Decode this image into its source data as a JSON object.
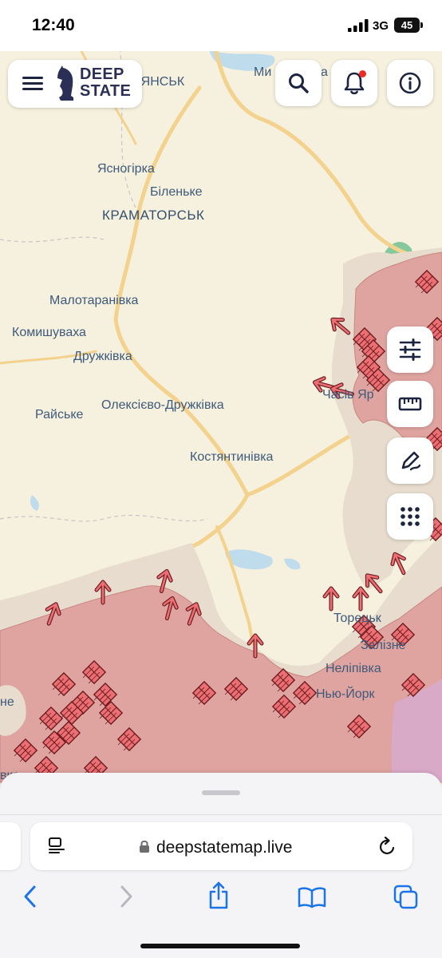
{
  "status_bar": {
    "time": "12:40",
    "network": "3G",
    "battery": "45"
  },
  "header": {
    "brand_line1": "DEEP",
    "brand_line2": "STATE",
    "menu_icon": "hamburger-menu-icon",
    "search_icon": "search-icon",
    "notifications_icon": "bell-icon",
    "info_icon": "info-icon",
    "notification_dot_color": "#ee2a24"
  },
  "map": {
    "colors": {
      "land": "#f6f0de",
      "occupied": "#dfa4a0",
      "contested": "#e7dccd",
      "roads": "#f3d28d",
      "forest": "#84c89c",
      "water": "#bedcec",
      "marker": "#e96b70",
      "other_zone": "#d9aac8"
    },
    "labels": [
      "ЛОВ'ЯНСЬК",
      "Ми",
      "а",
      "Ясногірка",
      "Біленьке",
      "КРАМАТОРСЬК",
      "Малотаранівка",
      "Комишуваха",
      "Дружківка",
      "Часів Яр",
      "Олексієво-Дружківка",
      "Райське",
      "Костянтинівка",
      "Торецьк",
      "Залізне",
      "Неліпівка",
      "Нью-Йорк",
      "не",
      "вка"
    ],
    "tools": [
      "filter-sliders-icon",
      "ruler-icon",
      "draw-pen-icon",
      "apps-grid-icon"
    ]
  },
  "browser": {
    "url": "deepstatemap.live",
    "reader_icon": "reader-mode-icon",
    "lock_icon": "lock-icon",
    "reload_icon": "reload-icon",
    "toolbar": [
      "back-icon",
      "forward-icon",
      "share-icon",
      "bookmarks-icon",
      "tabs-icon"
    ]
  }
}
